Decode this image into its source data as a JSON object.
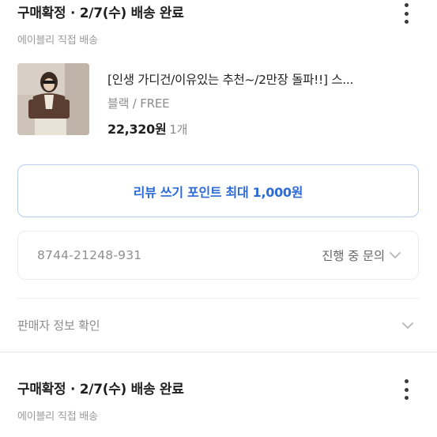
{
  "orders": [
    {
      "status": "구매확정 · 2/7(수) 배송 완료",
      "seller": "에이블리 직접 배송",
      "product": {
        "name": "[인생 가디건/이유있는 추천~/2만장 돌파!!] 스...",
        "option": "블랙 / FREE",
        "price": "22,320원",
        "quantity": "1개"
      },
      "review_button": "리뷰 쓰기 포인트 최대 1,000원",
      "inquiry": {
        "number": "8744-21248-931",
        "status": "진행 중 문의"
      },
      "seller_info": "판매자 정보 확인"
    },
    {
      "status": "구매확정 · 2/7(수) 배송 완료",
      "seller": "에이블리 직접 배송"
    }
  ],
  "icons": {
    "more": "kebab-menu-icon",
    "chevron": "chevron-down-icon"
  },
  "colors": {
    "accent": "#2c6bd6",
    "review_border": "#b8cdf2",
    "muted_text": "#8c8c8c"
  }
}
